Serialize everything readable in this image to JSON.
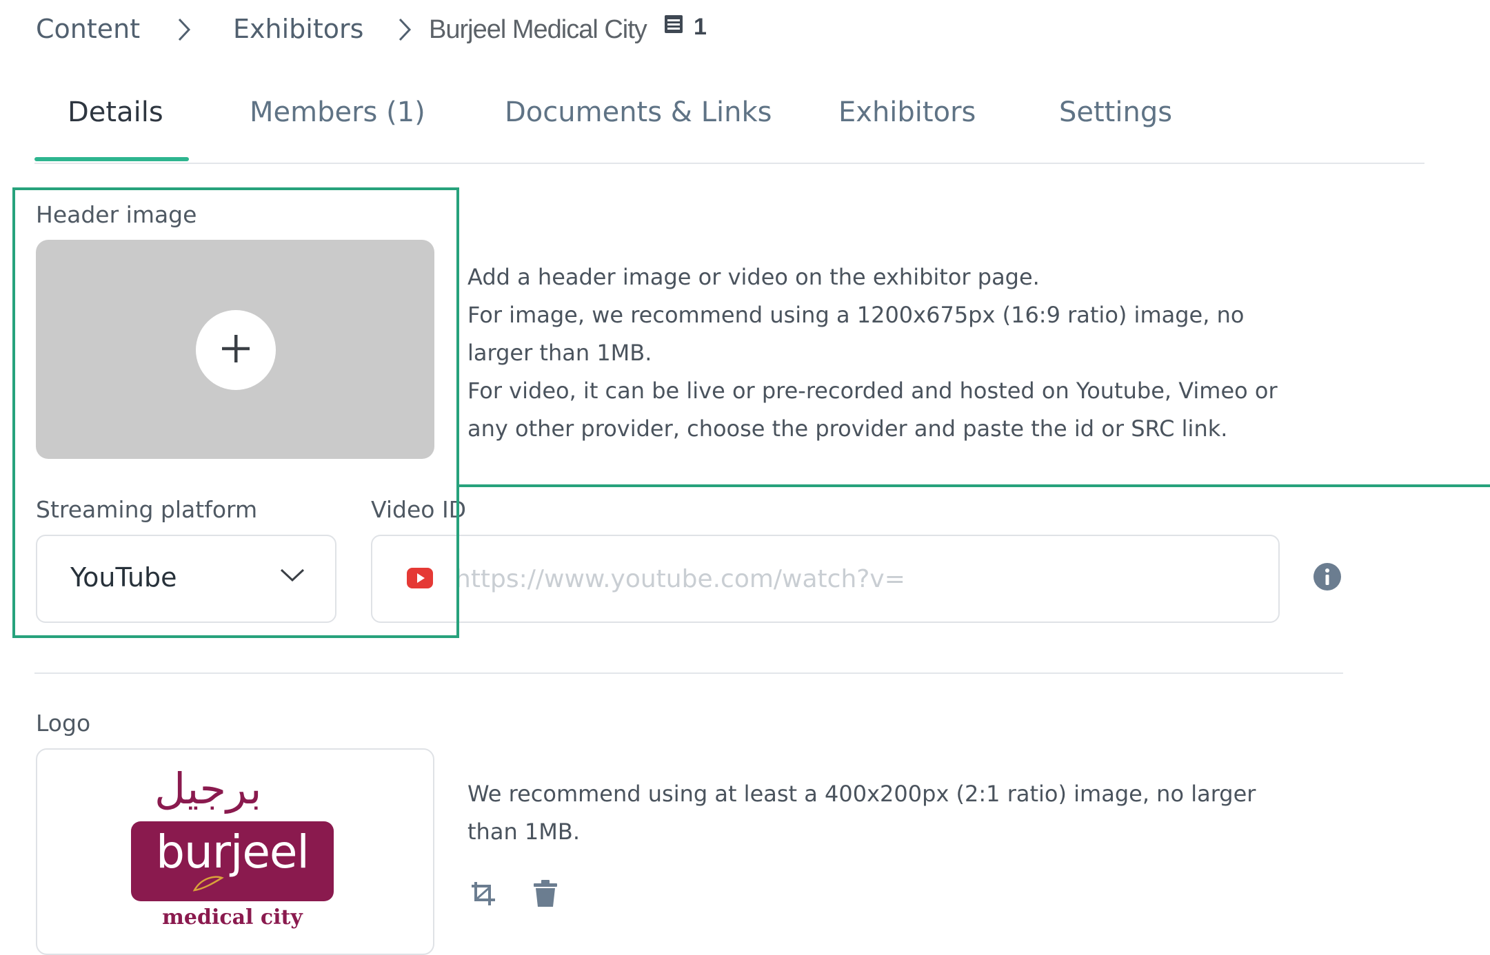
{
  "breadcrumb": {
    "items": [
      "Content",
      "Exhibitors"
    ],
    "current": "Burjeel Medical City",
    "count": "1"
  },
  "tabs": [
    {
      "label": "Details",
      "active": true
    },
    {
      "label": "Members (1)"
    },
    {
      "label": "Documents & Links"
    },
    {
      "label": "Exhibitors"
    },
    {
      "label": "Settings"
    }
  ],
  "header_image": {
    "label": "Header image",
    "help": [
      "Add a header image or video on the exhibitor page.",
      "For image, we recommend using a 1200x675px (16:9 ratio) image, no",
      "larger than 1MB.",
      "For video, it can be live or pre-recorded and hosted on Youtube, Vimeo or",
      "any other provider, choose the provider and paste the id or SRC link."
    ]
  },
  "streaming": {
    "label": "Streaming platform",
    "value": "YouTube"
  },
  "video": {
    "label": "Video ID",
    "placeholder": "https://www.youtube.com/watch?v=",
    "value": ""
  },
  "logo": {
    "label": "Logo",
    "arabic": "برجيل",
    "word": "burjeel",
    "sub": "medical city",
    "help": [
      "We recommend using at least a 400x200px (2:1 ratio) image, no larger",
      "than 1MB."
    ]
  },
  "colors": {
    "accent": "#2eb58f",
    "highlight": "#27a27c",
    "brand_logo": "#8a1a4e",
    "youtube_red": "#e53935",
    "info_icon": "#6b7d90"
  },
  "icons": [
    "chevron-right-icon",
    "document-list-icon",
    "plus-icon",
    "chevron-down-icon",
    "youtube-icon",
    "info-icon",
    "crop-icon",
    "trash-icon"
  ]
}
